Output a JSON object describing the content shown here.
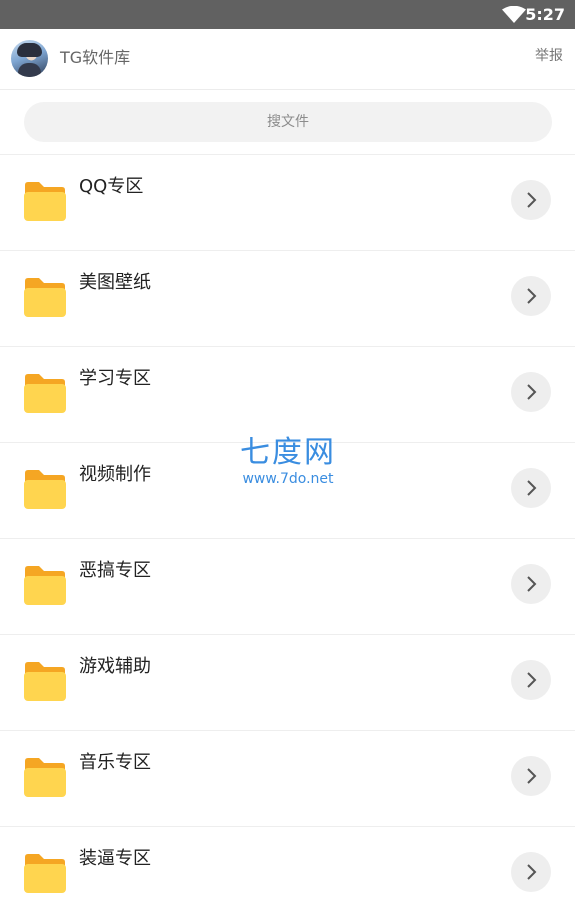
{
  "status_bar": {
    "time": "5:27",
    "wifi_icon": "wifi-icon"
  },
  "app_bar": {
    "title": "TG软件库",
    "report_label": "举报",
    "avatar": "avatar"
  },
  "search": {
    "placeholder": "搜文件"
  },
  "folders": [
    {
      "label": "QQ专区"
    },
    {
      "label": "美图壁纸"
    },
    {
      "label": "学习专区"
    },
    {
      "label": "视频制作"
    },
    {
      "label": "恶搞专区"
    },
    {
      "label": "游戏辅助"
    },
    {
      "label": "音乐专区"
    },
    {
      "label": "装逼专区"
    }
  ],
  "watermark": {
    "main": "七度网",
    "sub": "www.7do.net"
  },
  "colors": {
    "status_bar": "#616161",
    "folder_front": "#ffd54f",
    "folder_back": "#f5a623",
    "chevron_bg": "#eeeeee",
    "watermark": "#3a8de0"
  }
}
